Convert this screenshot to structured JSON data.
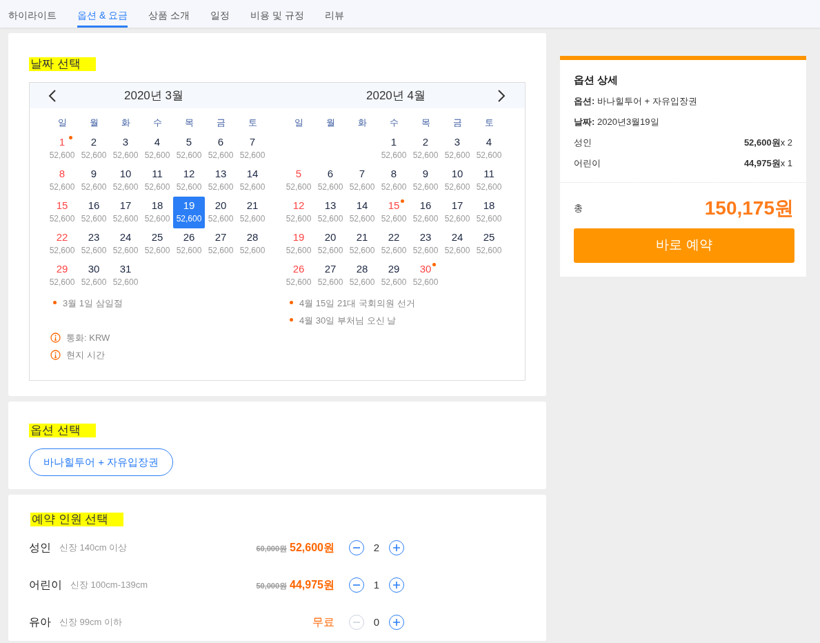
{
  "tabs": [
    {
      "label": "하이라이트",
      "selected": false
    },
    {
      "label": "옵션 & 요금",
      "selected": true
    },
    {
      "label": "상품 소개",
      "selected": false
    },
    {
      "label": "일정",
      "selected": false
    },
    {
      "label": "비용 및 규정",
      "selected": false
    },
    {
      "label": "리뷰",
      "selected": false
    }
  ],
  "date_section": {
    "title": "날짜 선택",
    "calendar": {
      "months": [
        {
          "title": "2020년 3월",
          "weekdays": [
            "일",
            "월",
            "화",
            "수",
            "목",
            "금",
            "토"
          ],
          "weeks": [
            [
              {
                "kind": "day",
                "day": "1",
                "price": "52,600",
                "holiday": true,
                "dot": true,
                "selected": false
              },
              {
                "kind": "day",
                "day": "2",
                "price": "52,600",
                "holiday": false,
                "dot": false,
                "selected": false
              },
              {
                "kind": "day",
                "day": "3",
                "price": "52,600",
                "holiday": false,
                "dot": false,
                "selected": false
              },
              {
                "kind": "day",
                "day": "4",
                "price": "52,600",
                "holiday": false,
                "dot": false,
                "selected": false
              },
              {
                "kind": "day",
                "day": "5",
                "price": "52,600",
                "holiday": false,
                "dot": false,
                "selected": false
              },
              {
                "kind": "day",
                "day": "6",
                "price": "52,600",
                "holiday": false,
                "dot": false,
                "selected": false
              },
              {
                "kind": "day",
                "day": "7",
                "price": "52,600",
                "holiday": false,
                "dot": false,
                "selected": false
              }
            ],
            [
              {
                "kind": "day",
                "day": "8",
                "price": "52,600",
                "holiday": true,
                "dot": false,
                "selected": false
              },
              {
                "kind": "day",
                "day": "9",
                "price": "52,600",
                "holiday": false,
                "dot": false,
                "selected": false
              },
              {
                "kind": "day",
                "day": "10",
                "price": "52,600",
                "holiday": false,
                "dot": false,
                "selected": false
              },
              {
                "kind": "day",
                "day": "11",
                "price": "52,600",
                "holiday": false,
                "dot": false,
                "selected": false
              },
              {
                "kind": "day",
                "day": "12",
                "price": "52,600",
                "holiday": false,
                "dot": false,
                "selected": false
              },
              {
                "kind": "day",
                "day": "13",
                "price": "52,600",
                "holiday": false,
                "dot": false,
                "selected": false
              },
              {
                "kind": "day",
                "day": "14",
                "price": "52,600",
                "holiday": false,
                "dot": false,
                "selected": false
              }
            ],
            [
              {
                "kind": "day",
                "day": "15",
                "price": "52,600",
                "holiday": true,
                "dot": false,
                "selected": false
              },
              {
                "kind": "day",
                "day": "16",
                "price": "52,600",
                "holiday": false,
                "dot": false,
                "selected": false
              },
              {
                "kind": "day",
                "day": "17",
                "price": "52,600",
                "holiday": false,
                "dot": false,
                "selected": false
              },
              {
                "kind": "day",
                "day": "18",
                "price": "52,600",
                "holiday": false,
                "dot": false,
                "selected": false
              },
              {
                "kind": "day",
                "day": "19",
                "price": "52,600",
                "holiday": false,
                "dot": false,
                "selected": true
              },
              {
                "kind": "day",
                "day": "20",
                "price": "52,600",
                "holiday": false,
                "dot": false,
                "selected": false
              },
              {
                "kind": "day",
                "day": "21",
                "price": "52,600",
                "holiday": false,
                "dot": false,
                "selected": false
              }
            ],
            [
              {
                "kind": "day",
                "day": "22",
                "price": "52,600",
                "holiday": true,
                "dot": false,
                "selected": false
              },
              {
                "kind": "day",
                "day": "23",
                "price": "52,600",
                "holiday": false,
                "dot": false,
                "selected": false
              },
              {
                "kind": "day",
                "day": "24",
                "price": "52,600",
                "holiday": false,
                "dot": false,
                "selected": false
              },
              {
                "kind": "day",
                "day": "25",
                "price": "52,600",
                "holiday": false,
                "dot": false,
                "selected": false
              },
              {
                "kind": "day",
                "day": "26",
                "price": "52,600",
                "holiday": false,
                "dot": false,
                "selected": false
              },
              {
                "kind": "day",
                "day": "27",
                "price": "52,600",
                "holiday": false,
                "dot": false,
                "selected": false
              },
              {
                "kind": "day",
                "day": "28",
                "price": "52,600",
                "holiday": false,
                "dot": false,
                "selected": false
              }
            ],
            [
              {
                "kind": "day",
                "day": "29",
                "price": "52,600",
                "holiday": true,
                "dot": false,
                "selected": false
              },
              {
                "kind": "day",
                "day": "30",
                "price": "52,600",
                "holiday": false,
                "dot": false,
                "selected": false
              },
              {
                "kind": "day",
                "day": "31",
                "price": "52,600",
                "holiday": false,
                "dot": false,
                "selected": false
              }
            ]
          ],
          "notes": [
            "3월 1일 삼일절"
          ]
        },
        {
          "title": "2020년 4월",
          "weekdays": [
            "일",
            "월",
            "화",
            "수",
            "목",
            "금",
            "토"
          ],
          "weeks": [
            [
              {
                "kind": "blank"
              },
              {
                "kind": "blank"
              },
              {
                "kind": "blank"
              },
              {
                "kind": "day",
                "day": "1",
                "price": "52,600",
                "holiday": false,
                "dot": false,
                "selected": false
              },
              {
                "kind": "day",
                "day": "2",
                "price": "52,600",
                "holiday": false,
                "dot": false,
                "selected": false
              },
              {
                "kind": "day",
                "day": "3",
                "price": "52,600",
                "holiday": false,
                "dot": false,
                "selected": false
              },
              {
                "kind": "day",
                "day": "4",
                "price": "52,600",
                "holiday": false,
                "dot": false,
                "selected": false
              }
            ],
            [
              {
                "kind": "day",
                "day": "5",
                "price": "52,600",
                "holiday": true,
                "dot": false,
                "selected": false
              },
              {
                "kind": "day",
                "day": "6",
                "price": "52,600",
                "holiday": false,
                "dot": false,
                "selected": false
              },
              {
                "kind": "day",
                "day": "7",
                "price": "52,600",
                "holiday": false,
                "dot": false,
                "selected": false
              },
              {
                "kind": "day",
                "day": "8",
                "price": "52,600",
                "holiday": false,
                "dot": false,
                "selected": false
              },
              {
                "kind": "day",
                "day": "9",
                "price": "52,600",
                "holiday": false,
                "dot": false,
                "selected": false
              },
              {
                "kind": "day",
                "day": "10",
                "price": "52,600",
                "holiday": false,
                "dot": false,
                "selected": false
              },
              {
                "kind": "day",
                "day": "11",
                "price": "52,600",
                "holiday": false,
                "dot": false,
                "selected": false
              }
            ],
            [
              {
                "kind": "day",
                "day": "12",
                "price": "52,600",
                "holiday": true,
                "dot": false,
                "selected": false
              },
              {
                "kind": "day",
                "day": "13",
                "price": "52,600",
                "holiday": false,
                "dot": false,
                "selected": false
              },
              {
                "kind": "day",
                "day": "14",
                "price": "52,600",
                "holiday": false,
                "dot": false,
                "selected": false
              },
              {
                "kind": "day",
                "day": "15",
                "price": "52,600",
                "holiday": true,
                "dot": true,
                "selected": false
              },
              {
                "kind": "day",
                "day": "16",
                "price": "52,600",
                "holiday": false,
                "dot": false,
                "selected": false
              },
              {
                "kind": "day",
                "day": "17",
                "price": "52,600",
                "holiday": false,
                "dot": false,
                "selected": false
              },
              {
                "kind": "day",
                "day": "18",
                "price": "52,600",
                "holiday": false,
                "dot": false,
                "selected": false
              }
            ],
            [
              {
                "kind": "day",
                "day": "19",
                "price": "52,600",
                "holiday": true,
                "dot": false,
                "selected": false
              },
              {
                "kind": "day",
                "day": "20",
                "price": "52,600",
                "holiday": false,
                "dot": false,
                "selected": false
              },
              {
                "kind": "day",
                "day": "21",
                "price": "52,600",
                "holiday": false,
                "dot": false,
                "selected": false
              },
              {
                "kind": "day",
                "day": "22",
                "price": "52,600",
                "holiday": false,
                "dot": false,
                "selected": false
              },
              {
                "kind": "day",
                "day": "23",
                "price": "52,600",
                "holiday": false,
                "dot": false,
                "selected": false
              },
              {
                "kind": "day",
                "day": "24",
                "price": "52,600",
                "holiday": false,
                "dot": false,
                "selected": false
              },
              {
                "kind": "day",
                "day": "25",
                "price": "52,600",
                "holiday": false,
                "dot": false,
                "selected": false
              }
            ],
            [
              {
                "kind": "day",
                "day": "26",
                "price": "52,600",
                "holiday": true,
                "dot": false,
                "selected": false
              },
              {
                "kind": "day",
                "day": "27",
                "price": "52,600",
                "holiday": false,
                "dot": false,
                "selected": false
              },
              {
                "kind": "day",
                "day": "28",
                "price": "52,600",
                "holiday": false,
                "dot": false,
                "selected": false
              },
              {
                "kind": "day",
                "day": "29",
                "price": "52,600",
                "holiday": false,
                "dot": false,
                "selected": false
              },
              {
                "kind": "day",
                "day": "30",
                "price": "52,600",
                "holiday": true,
                "dot": true,
                "selected": false
              }
            ]
          ],
          "notes": [
            "4월 15일 21대 국회의원 선거",
            "4월 30일 부처님 오신 날"
          ]
        }
      ],
      "info": [
        "통화: KRW",
        "현지 시간"
      ]
    }
  },
  "option_section": {
    "title": "옵션 선택",
    "options": [
      {
        "label": "바나힐투어 + 자유입장권",
        "selected": true
      }
    ]
  },
  "people_section": {
    "title": "예약 인원 선택",
    "rows": [
      {
        "kind": "discount",
        "name": "성인",
        "desc": "신장 140cm 이상",
        "original_price": "60,000원",
        "price": "52,600원",
        "count": "2",
        "minus_disabled": false
      },
      {
        "kind": "discount",
        "name": "어린이",
        "desc": "신장 100cm-139cm",
        "original_price": "50,000원",
        "price": "44,975원",
        "count": "1",
        "minus_disabled": false
      },
      {
        "kind": "free",
        "name": "유아",
        "desc": "신장 99cm 이하",
        "price": "무료",
        "count": "0",
        "minus_disabled": true
      }
    ]
  },
  "summary": {
    "title": "옵션 상세",
    "lines": [
      "**옵션:** 바나힐투어 + 자유입장권",
      "**날짜:** 2020년3월19일"
    ],
    "items": [
      {
        "label": "성인",
        "value": "**52,600원**x 2"
      },
      {
        "label": "어린이",
        "value": "**44,975원**x 1"
      }
    ],
    "total_label": "총",
    "total": "150,175원",
    "book_button": "바로 예약"
  }
}
